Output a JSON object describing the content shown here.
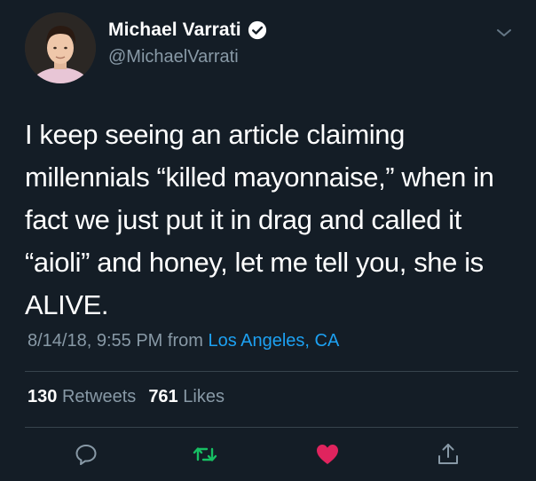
{
  "author": {
    "display_name": "Michael Varrati",
    "handle": "@MichaelVarrati",
    "verified": true,
    "avatar_icon": "profile-photo"
  },
  "tweet": {
    "text": "I keep seeing an article claiming\nmillennials “killed mayonnaise,” when in\nfact we just put it in drag and called it\n“aioli” and honey, let me tell you, she is\nALIVE.",
    "timestamp": "8/14/18, 9:55 PM",
    "from_label": "from",
    "location": "Los Angeles, CA"
  },
  "stats": {
    "retweets_count": "130",
    "retweets_label": "Retweets",
    "likes_count": "761",
    "likes_label": "Likes"
  },
  "actions": {
    "reply_icon": "speech-bubble-icon",
    "retweet_icon": "retweet-icon",
    "like_icon": "heart-icon",
    "share_icon": "share-icon",
    "liked": true
  },
  "colors": {
    "background": "#141d26",
    "text_primary": "#ffffff",
    "text_secondary": "#8899a6",
    "link": "#1da1f2",
    "retweet": "#17bf63",
    "like": "#e0245e",
    "divider": "#38444d"
  }
}
